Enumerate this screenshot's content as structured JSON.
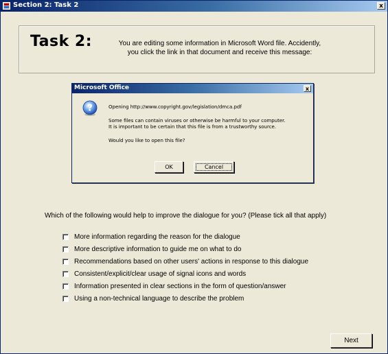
{
  "window": {
    "title": "Section 2: Task 2",
    "close_label": "x"
  },
  "task": {
    "heading": "Task 2:",
    "description_line1": "You are editing some information in Microsoft Word file. Accidently,",
    "description_line2": "you click the link in that document and receive this message:"
  },
  "dialog": {
    "title": "Microsoft Office",
    "close_label": "x",
    "icon": "question-icon",
    "line_opening": "Opening http://www.copyright.gov/legislation/dmca.pdf",
    "line_warning1": "Some files can contain viruses or otherwise be harmful to your computer.",
    "line_warning2": "It is important to be certain that this file is from a trustworthy source.",
    "line_prompt": "Would you like to open this file?",
    "ok_label": "OK",
    "cancel_label": "Cancel"
  },
  "question": "Which of the following would help to improve the dialogue for you? (Please tick all that apply)",
  "options": [
    {
      "label": "More information regarding the reason for the dialogue",
      "checked": false
    },
    {
      "label": "More descriptive information to guide me on what to do",
      "checked": false
    },
    {
      "label": "Recommendations based on other users' actions in response to this dialogue",
      "checked": false
    },
    {
      "label": "Consistent/explicit/clear usage of signal icons and words",
      "checked": false
    },
    {
      "label": "Information presented in clear sections in the form of question/answer",
      "checked": false
    },
    {
      "label": "Using a non-technical language to describe the problem",
      "checked": false
    }
  ],
  "next_label": "Next",
  "colors": {
    "background": "#ece9d8",
    "titlebar_start": "#0a246a",
    "titlebar_end": "#a6caf0"
  }
}
